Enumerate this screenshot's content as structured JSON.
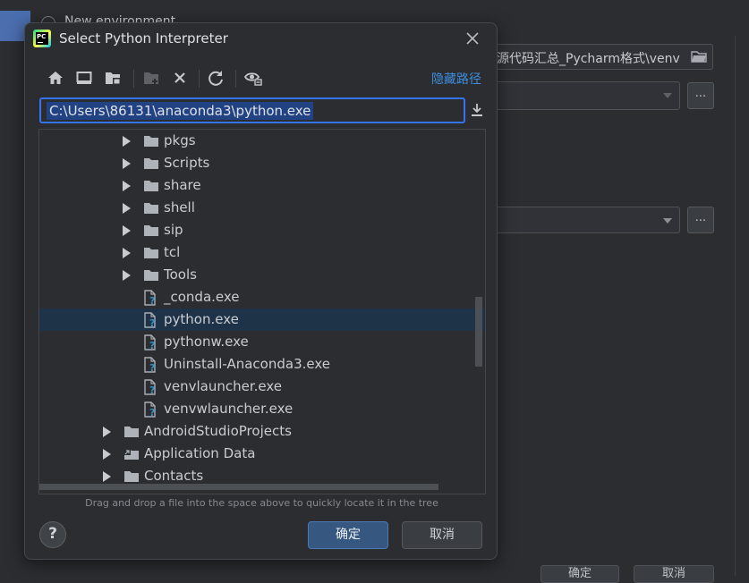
{
  "background": {
    "radio_label": "New environment",
    "path_field_value": "源代码汇总_Pycharm格式\\venv",
    "ellipsis_label": "...",
    "bottom_buttons": [
      "确定",
      "取消"
    ]
  },
  "dialog": {
    "title": "Select Python Interpreter",
    "toolbar": {
      "icons": [
        "home-icon",
        "desktop-icon",
        "project-folder-icon",
        "new-folder-icon",
        "delete-icon",
        "refresh-icon",
        "show-hidden-icon"
      ],
      "hide_path_label": "隐藏路径"
    },
    "path_input": "C:\\Users\\86131\\anaconda3\\python.exe",
    "tree": [
      {
        "label": "pkgs",
        "type": "folder",
        "expandable": true,
        "depth": 2
      },
      {
        "label": "Scripts",
        "type": "folder",
        "expandable": true,
        "depth": 2
      },
      {
        "label": "share",
        "type": "folder",
        "expandable": true,
        "depth": 2
      },
      {
        "label": "shell",
        "type": "folder",
        "expandable": true,
        "depth": 2
      },
      {
        "label": "sip",
        "type": "folder",
        "expandable": true,
        "depth": 2
      },
      {
        "label": "tcl",
        "type": "folder",
        "expandable": true,
        "depth": 2
      },
      {
        "label": "Tools",
        "type": "folder",
        "expandable": true,
        "depth": 2
      },
      {
        "label": "_conda.exe",
        "type": "file",
        "expandable": false,
        "depth": 2
      },
      {
        "label": "python.exe",
        "type": "file",
        "expandable": false,
        "depth": 2,
        "selected": true
      },
      {
        "label": "pythonw.exe",
        "type": "file",
        "expandable": false,
        "depth": 2
      },
      {
        "label": "Uninstall-Anaconda3.exe",
        "type": "file",
        "expandable": false,
        "depth": 2
      },
      {
        "label": "venvlauncher.exe",
        "type": "file",
        "expandable": false,
        "depth": 2
      },
      {
        "label": "venvwlauncher.exe",
        "type": "file",
        "expandable": false,
        "depth": 2
      },
      {
        "label": "AndroidStudioProjects",
        "type": "folder",
        "expandable": true,
        "depth": 1
      },
      {
        "label": "Application Data",
        "type": "folder-link",
        "expandable": true,
        "depth": 1
      },
      {
        "label": "Contacts",
        "type": "folder",
        "expandable": true,
        "depth": 1
      }
    ],
    "hint": "Drag and drop a file into the space above to quickly locate it in the tree",
    "help_label": "?",
    "ok_label": "确定",
    "cancel_label": "取消"
  },
  "colors": {
    "accent": "#3574f0",
    "link": "#3d8ee0",
    "selection": "#1e3347",
    "ok_button": "#365880"
  }
}
